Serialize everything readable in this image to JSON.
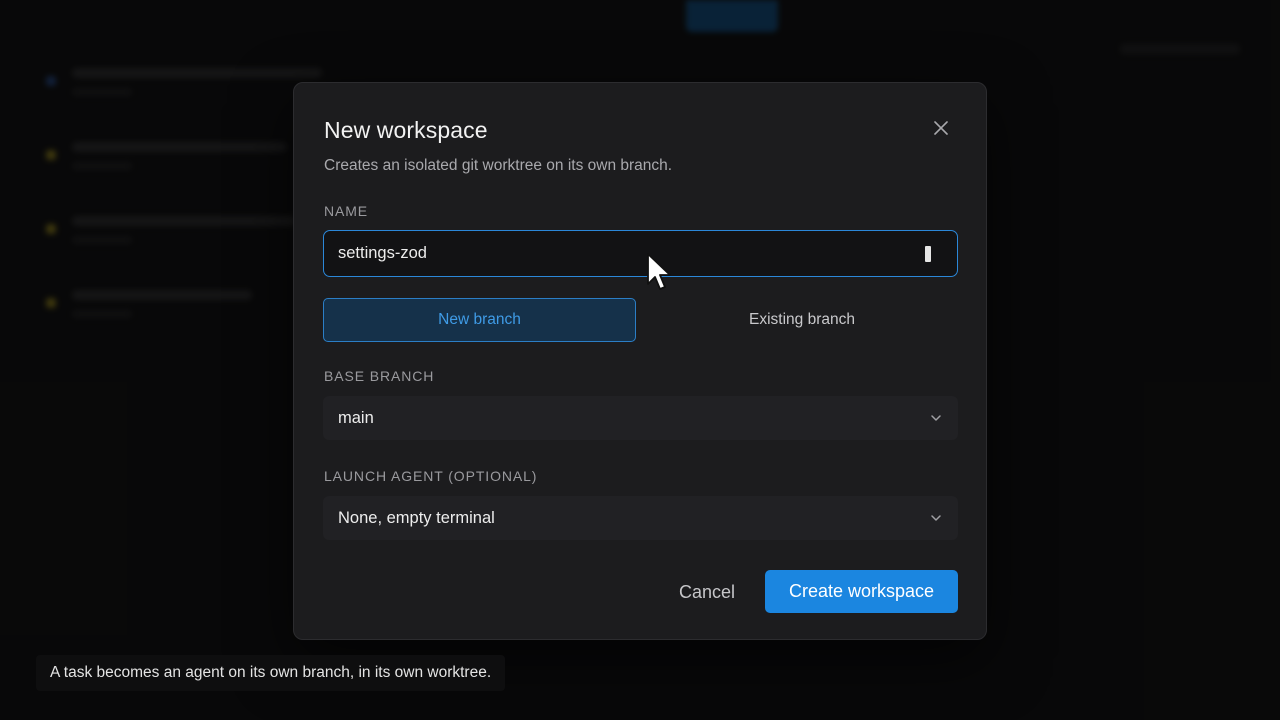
{
  "dialog": {
    "title": "New workspace",
    "subtitle": "Creates an isolated git worktree on its own branch.",
    "close_icon": "close-icon"
  },
  "name_field": {
    "label": "NAME",
    "value": "settings-zod"
  },
  "branch_mode": {
    "options": [
      "New branch",
      "Existing branch"
    ],
    "selected": "New branch"
  },
  "base_branch": {
    "label": "BASE BRANCH",
    "value": "main",
    "icon": "chevron-down-icon"
  },
  "launch_agent": {
    "label": "LAUNCH AGENT (OPTIONAL)",
    "value": "None, empty terminal",
    "icon": "chevron-down-icon"
  },
  "actions": {
    "cancel": "Cancel",
    "create": "Create workspace"
  },
  "caption": "A task becomes an agent on its own branch, in its own worktree.",
  "colors": {
    "accent": "#1b86e0",
    "dialog_bg": "#1c1c1e",
    "background": "#0b0b0c"
  }
}
